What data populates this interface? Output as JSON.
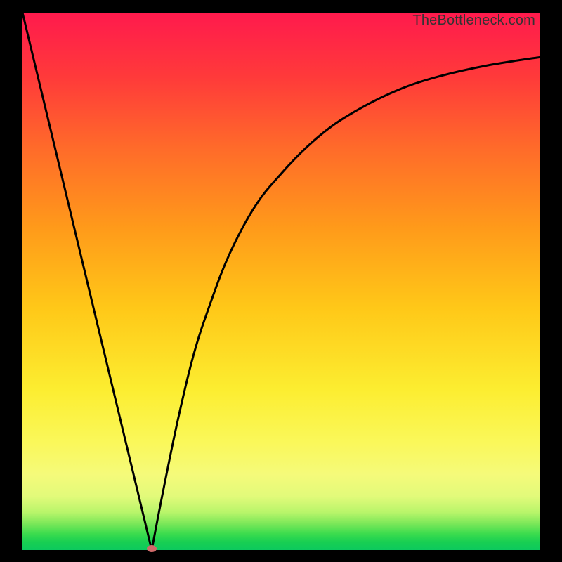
{
  "watermark": "TheBottleneck.com",
  "colors": {
    "background": "#000000",
    "curve": "#000000",
    "marker": "#d06a6a"
  },
  "chart_data": {
    "type": "line",
    "title": "",
    "xlabel": "",
    "ylabel": "",
    "xlim": [
      0,
      100
    ],
    "ylim": [
      0,
      100
    ],
    "grid": false,
    "series": [
      {
        "name": "left-branch",
        "x": [
          0,
          5,
          10,
          15,
          20,
          25
        ],
        "y": [
          100,
          80,
          60,
          40,
          20,
          0
        ]
      },
      {
        "name": "right-branch",
        "x": [
          25,
          27,
          30,
          33,
          36,
          40,
          45,
          50,
          55,
          60,
          65,
          70,
          75,
          80,
          85,
          90,
          95,
          100
        ],
        "y": [
          0,
          10,
          24,
          36,
          45,
          55,
          64,
          70,
          75,
          79,
          82,
          84.5,
          86.5,
          88,
          89.2,
          90.2,
          91,
          91.7
        ]
      }
    ],
    "annotations": [
      {
        "name": "minimum-marker",
        "x": 25,
        "y": 0
      }
    ]
  }
}
